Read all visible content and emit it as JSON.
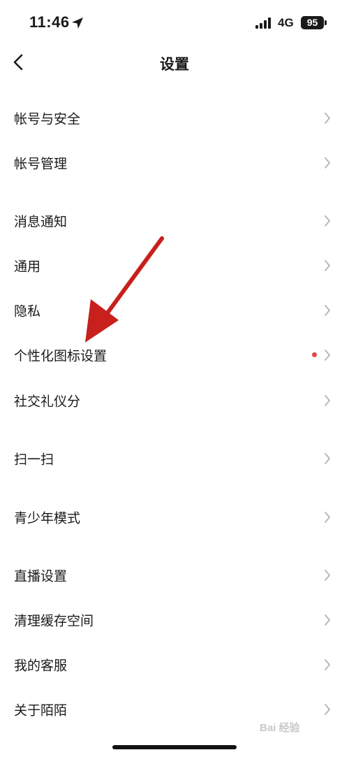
{
  "status_bar": {
    "time": "11:46",
    "network": "4G",
    "battery": "95"
  },
  "nav": {
    "title": "设置"
  },
  "settings": [
    {
      "label": "帐号与安全"
    },
    {
      "label": "帐号管理"
    },
    {
      "label": "消息通知"
    },
    {
      "label": "通用"
    },
    {
      "label": "隐私"
    },
    {
      "label": "个性化图标设置",
      "badge": "red-dot"
    },
    {
      "label": "社交礼仪分"
    },
    {
      "label": "扫一扫"
    },
    {
      "label": "青少年模式"
    },
    {
      "label": "直播设置"
    },
    {
      "label": "清理缓存空间"
    },
    {
      "label": "我的客服"
    },
    {
      "label": "关于陌陌"
    }
  ],
  "watermark": "Bai 经验",
  "colors": {
    "badge": "#e04848",
    "arrow": "#c8201d",
    "chevron": "#b4b4b4"
  }
}
